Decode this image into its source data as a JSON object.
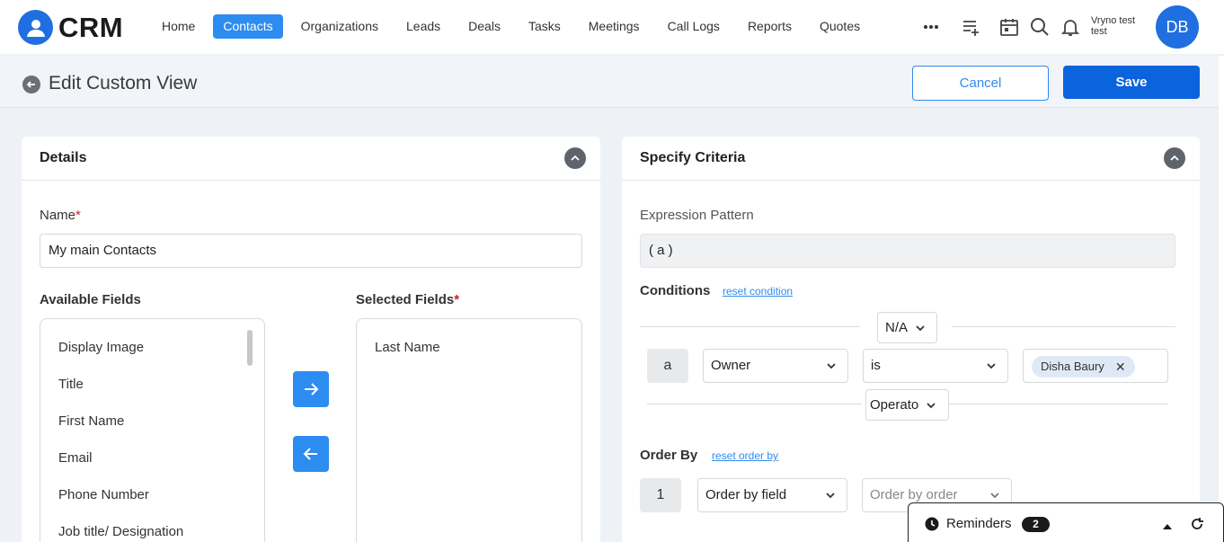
{
  "app": {
    "logo_text": "CRM"
  },
  "nav": {
    "items": [
      {
        "label": "Home",
        "active": false
      },
      {
        "label": "Contacts",
        "active": true
      },
      {
        "label": "Organizations",
        "active": false
      },
      {
        "label": "Leads",
        "active": false
      },
      {
        "label": "Deals",
        "active": false
      },
      {
        "label": "Tasks",
        "active": false
      },
      {
        "label": "Meetings",
        "active": false
      },
      {
        "label": "Call Logs",
        "active": false
      },
      {
        "label": "Reports",
        "active": false
      },
      {
        "label": "Quotes",
        "active": false
      }
    ],
    "more_label": "•••"
  },
  "user": {
    "name_line1": "Vryno test",
    "name_line2": "test",
    "initials": "DB"
  },
  "page": {
    "title": "Edit Custom View",
    "cancel_label": "Cancel",
    "save_label": "Save"
  },
  "details": {
    "title": "Details",
    "name_label": "Name",
    "required_mark": "*",
    "name_value": "My main Contacts",
    "available_label": "Available Fields",
    "available_fields": [
      "Display Image",
      "Title",
      "First Name",
      "Email",
      "Phone Number",
      "Job title/ Designation"
    ],
    "selected_label": "Selected Fields",
    "selected_fields": [
      "Last Name"
    ]
  },
  "criteria": {
    "title": "Specify Criteria",
    "expression_label": "Expression Pattern",
    "expression_value": "( a )",
    "conditions_label": "Conditions",
    "reset_condition": "reset condition",
    "top_operator": "N/A",
    "condition": {
      "letter": "a",
      "field": "Owner",
      "operator": "is",
      "value_chip": "Disha Baury",
      "chip_close": "✕"
    },
    "bottom_operator": "Operato",
    "order_by_label": "Order By",
    "reset_order_by": "reset order by",
    "order": {
      "index": "1",
      "field": "Order by field",
      "order_placeholder": "Order by order"
    }
  },
  "reminders": {
    "label": "Reminders",
    "count": "2"
  },
  "colors": {
    "primary": "#2d8cf0",
    "save": "#0b63dd",
    "brand": "#1f6fe0",
    "required": "#c0262d"
  }
}
